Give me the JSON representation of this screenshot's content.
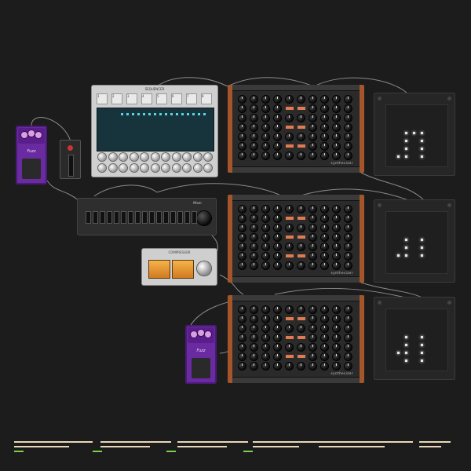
{
  "sequencer": {
    "title": "SEQUENCER",
    "tabs": [
      "1",
      "2",
      "3",
      "4",
      "5",
      "6",
      "7",
      "8"
    ],
    "pattern_label": "PATTERN",
    "accent": "#5ad4e6"
  },
  "synths": [
    {
      "brand": "synthesizer",
      "accent": "#a4562a"
    },
    {
      "brand": "synthesizer",
      "accent": "#a4562a"
    },
    {
      "brand": "synthesizer",
      "accent": "#a4562a"
    }
  ],
  "grids": [
    {
      "label": "",
      "leds": [
        [
          20,
          12
        ],
        [
          30,
          12
        ],
        [
          40,
          12
        ],
        [
          20,
          22
        ],
        [
          40,
          22
        ],
        [
          20,
          32
        ],
        [
          40,
          32
        ],
        [
          10,
          42
        ],
        [
          20,
          42
        ],
        [
          40,
          42
        ]
      ]
    },
    {
      "label": "",
      "leds": [
        [
          20,
          12
        ],
        [
          40,
          12
        ],
        [
          20,
          22
        ],
        [
          40,
          22
        ],
        [
          10,
          32
        ],
        [
          20,
          32
        ],
        [
          40,
          32
        ]
      ]
    },
    {
      "label": "",
      "leds": [
        [
          20,
          12
        ],
        [
          40,
          12
        ],
        [
          20,
          22
        ],
        [
          40,
          22
        ],
        [
          10,
          32
        ],
        [
          20,
          32
        ],
        [
          40,
          32
        ],
        [
          20,
          42
        ],
        [
          40,
          42
        ]
      ]
    }
  ],
  "pedals": [
    {
      "logo": "Fuzz",
      "color": "#6a2aa0"
    },
    {
      "logo": "Fuzz",
      "color": "#6a2aa0"
    }
  ],
  "mixer": {
    "name": "Mixer",
    "channels": 16
  },
  "vu": {
    "name": "COMPRESSOR"
  },
  "timeline": {
    "segment_color": "#e8d8b8",
    "marker_color": "#7ad04a"
  },
  "icons": {
    "knob": "knob-icon",
    "led": "led-icon",
    "cable": "cable-icon"
  }
}
